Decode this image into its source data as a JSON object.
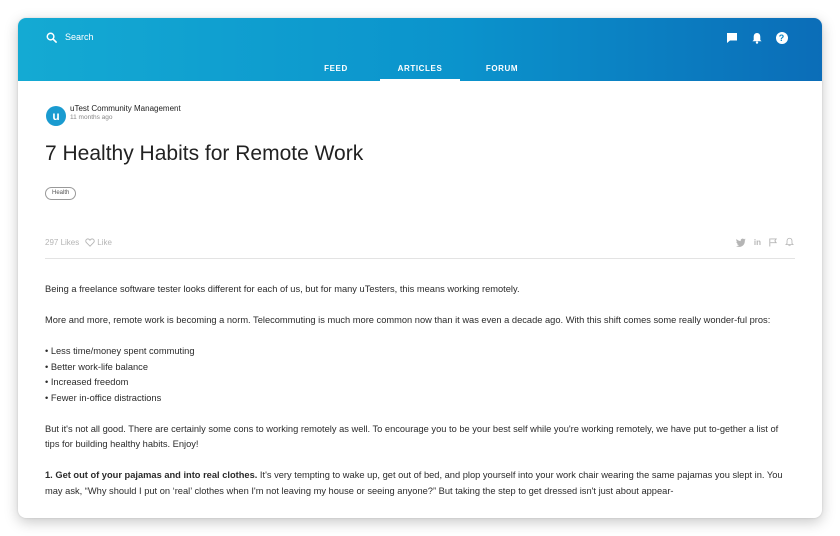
{
  "header": {
    "search_placeholder": "Search",
    "tabs": [
      "FEED",
      "ARTICLES",
      "FORUM"
    ],
    "active_tab": "ARTICLES",
    "icons": [
      "chat-icon",
      "bell-icon",
      "help-icon"
    ],
    "help_glyph": "?"
  },
  "colors": {
    "header_gradient_start": "#14aad3",
    "header_gradient_end": "#0b6db8",
    "text": "#222222",
    "muted": "#b5b5b5"
  },
  "article": {
    "author": "uTest Community Management",
    "avatar_letter": "u",
    "time_ago": "11 months ago",
    "title": "7 Healthy Habits for Remote Work",
    "tag": "Health",
    "likes_count": "297 Likes",
    "like_label": "Like",
    "share_icons": [
      "twitter-icon",
      "linkedin-icon",
      "flag-icon",
      "bell-icon"
    ],
    "share_labels": {
      "twitter": "t",
      "linkedin": "in"
    },
    "paragraphs": [
      "Being a freelance software tester looks different for each of us, but for many uTesters, this means working remotely.",
      "More and more, remote work is becoming a norm. Telecommuting is much more common now than it was even a decade ago. With this shift comes some really wonder-ful pros:"
    ],
    "pros": [
      "Less time/money spent commuting",
      "Better work-life balance",
      "Increased freedom",
      "Fewer in-office distractions"
    ],
    "paragraph_cons": "But it's not all good. There are certainly some cons to working remotely as well. To encourage you to be your best self while you're working remotely, we have put to-gether a list of tips for building healthy habits. Enjoy!",
    "habit1_heading": "1. Get out of your pajamas and into real clothes.",
    "habit1_text": " It's very tempting to wake up, get out of bed, and plop yourself into your work chair wearing the same pajamas you slept in. You may ask, “Why should I put on ‘real’ clothes when I'm not leaving my house or seeing anyone?” But taking the step to get dressed isn't just about appear-"
  }
}
